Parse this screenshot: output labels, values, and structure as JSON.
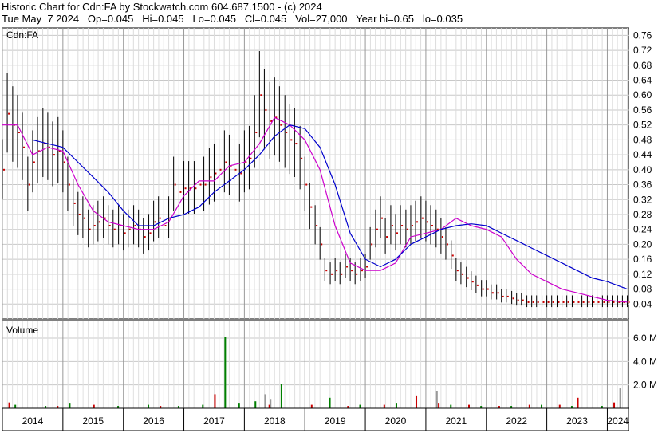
{
  "header": {
    "line1": "Historic Chart for Cdn:FA by Stockwatch.com 604.687.1500 - (c) 2024",
    "line2": "Tue May  7 2024   Op=0.045   Hi=0.045   Lo=0.045   Cl=0.045   Vol=27,000   Year hi=0.65   lo=0.035"
  },
  "chart_data": [
    {
      "type": "line",
      "title": "Cdn:FA",
      "ylim": [
        0.0,
        0.78
      ],
      "y_ticks": [
        "0.76",
        "0.72",
        "0.68",
        "0.64",
        "0.60",
        "0.56",
        "0.52",
        "0.48",
        "0.44",
        "0.40",
        "0.36",
        "0.32",
        "0.28",
        "0.24",
        "0.20",
        "0.16",
        "0.12",
        "0.08",
        "0.04"
      ],
      "x_labels": [
        "2014",
        "2015",
        "2016",
        "2017",
        "2018",
        "2019",
        "2020",
        "2021",
        "2022",
        "2023",
        "2024"
      ],
      "grid": true,
      "series": [
        {
          "style": "price-bars",
          "color": "#000000",
          "x": [
            2014.0,
            2014.08,
            2014.17,
            2014.25,
            2014.33,
            2014.42,
            2014.5,
            2014.58,
            2014.67,
            2014.75,
            2014.83,
            2014.92,
            2015.0,
            2015.08,
            2015.17,
            2015.25,
            2015.33,
            2015.42,
            2015.5,
            2015.58,
            2015.67,
            2015.75,
            2015.83,
            2015.92,
            2016.0,
            2016.08,
            2016.17,
            2016.25,
            2016.33,
            2016.42,
            2016.5,
            2016.58,
            2016.67,
            2016.75,
            2016.83,
            2016.92,
            2017.0,
            2017.08,
            2017.17,
            2017.25,
            2017.33,
            2017.42,
            2017.5,
            2017.58,
            2017.67,
            2017.75,
            2017.83,
            2017.92,
            2018.0,
            2018.08,
            2018.17,
            2018.25,
            2018.33,
            2018.42,
            2018.5,
            2018.58,
            2018.67,
            2018.75,
            2018.83,
            2018.92,
            2019.0,
            2019.08,
            2019.17,
            2019.25,
            2019.33,
            2019.42,
            2019.5,
            2019.58,
            2019.67,
            2019.75,
            2019.83,
            2019.92,
            2020.0,
            2020.08,
            2020.17,
            2020.25,
            2020.33,
            2020.42,
            2020.5,
            2020.58,
            2020.67,
            2020.75,
            2020.83,
            2020.92,
            2021.0,
            2021.08,
            2021.17,
            2021.25,
            2021.33,
            2021.42,
            2021.5,
            2021.58,
            2021.67,
            2021.75,
            2021.83,
            2021.92,
            2022.0,
            2022.08,
            2022.17,
            2022.25,
            2022.33,
            2022.42,
            2022.5,
            2022.58,
            2022.67,
            2022.75,
            2022.83,
            2022.92,
            2023.0,
            2023.08,
            2023.17,
            2023.25,
            2023.33,
            2023.42,
            2023.5,
            2023.58,
            2023.67,
            2023.75,
            2023.83,
            2023.92,
            2024.0,
            2024.08,
            2024.17,
            2024.25,
            2024.33
          ],
          "close": [
            0.4,
            0.55,
            0.52,
            0.5,
            0.46,
            0.36,
            0.42,
            0.45,
            0.47,
            0.46,
            0.44,
            0.45,
            0.42,
            0.36,
            0.31,
            0.28,
            0.27,
            0.24,
            0.25,
            0.26,
            0.27,
            0.25,
            0.24,
            0.25,
            0.23,
            0.24,
            0.25,
            0.24,
            0.22,
            0.23,
            0.26,
            0.27,
            0.25,
            0.27,
            0.36,
            0.34,
            0.35,
            0.35,
            0.35,
            0.36,
            0.36,
            0.38,
            0.39,
            0.4,
            0.42,
            0.41,
            0.4,
            0.39,
            0.42,
            0.43,
            0.5,
            0.6,
            0.56,
            0.53,
            0.54,
            0.52,
            0.5,
            0.48,
            0.47,
            0.43,
            0.36,
            0.3,
            0.25,
            0.2,
            0.13,
            0.12,
            0.13,
            0.12,
            0.14,
            0.13,
            0.12,
            0.13,
            0.14,
            0.2,
            0.24,
            0.27,
            0.22,
            0.25,
            0.23,
            0.25,
            0.24,
            0.25,
            0.26,
            0.27,
            0.26,
            0.25,
            0.24,
            0.22,
            0.2,
            0.17,
            0.13,
            0.12,
            0.11,
            0.1,
            0.09,
            0.08,
            0.08,
            0.07,
            0.07,
            0.06,
            0.06,
            0.055,
            0.05,
            0.05,
            0.045,
            0.045,
            0.045,
            0.045,
            0.045,
            0.045,
            0.045,
            0.045,
            0.045,
            0.045,
            0.045,
            0.045,
            0.045,
            0.045,
            0.045,
            0.045,
            0.045,
            0.045,
            0.045,
            0.045,
            0.045
          ]
        },
        {
          "style": "moving-average-short",
          "color": "#cc00cc",
          "x": [
            2014.0,
            2014.25,
            2014.5,
            2014.75,
            2015.0,
            2015.25,
            2015.5,
            2015.75,
            2016.0,
            2016.25,
            2016.5,
            2016.75,
            2017.0,
            2017.25,
            2017.5,
            2017.75,
            2018.0,
            2018.25,
            2018.5,
            2018.75,
            2019.0,
            2019.25,
            2019.5,
            2019.75,
            2020.0,
            2020.25,
            2020.5,
            2020.75,
            2021.0,
            2021.25,
            2021.5,
            2021.75,
            2022.0,
            2022.25,
            2022.5,
            2022.75,
            2023.0,
            2023.25,
            2023.5,
            2023.75,
            2024.0,
            2024.33
          ],
          "y": [
            0.52,
            0.52,
            0.44,
            0.46,
            0.45,
            0.36,
            0.29,
            0.26,
            0.25,
            0.24,
            0.24,
            0.26,
            0.33,
            0.37,
            0.37,
            0.41,
            0.42,
            0.47,
            0.54,
            0.52,
            0.48,
            0.4,
            0.25,
            0.15,
            0.13,
            0.13,
            0.15,
            0.22,
            0.23,
            0.24,
            0.27,
            0.25,
            0.24,
            0.22,
            0.16,
            0.12,
            0.1,
            0.08,
            0.07,
            0.06,
            0.05,
            0.045
          ]
        },
        {
          "style": "moving-average-long",
          "color": "#0000cc",
          "x": [
            2014.5,
            2014.75,
            2015.0,
            2015.25,
            2015.5,
            2015.75,
            2016.0,
            2016.25,
            2016.5,
            2016.75,
            2017.0,
            2017.25,
            2017.5,
            2017.75,
            2018.0,
            2018.25,
            2018.5,
            2018.75,
            2019.0,
            2019.25,
            2019.5,
            2019.75,
            2020.0,
            2020.25,
            2020.5,
            2020.75,
            2021.0,
            2021.25,
            2021.5,
            2021.75,
            2022.0,
            2022.25,
            2022.5,
            2022.75,
            2023.0,
            2023.25,
            2023.5,
            2023.75,
            2024.0,
            2024.33
          ],
          "y": [
            0.48,
            0.47,
            0.46,
            0.42,
            0.38,
            0.34,
            0.29,
            0.25,
            0.25,
            0.27,
            0.28,
            0.3,
            0.34,
            0.37,
            0.4,
            0.44,
            0.49,
            0.52,
            0.51,
            0.46,
            0.36,
            0.23,
            0.16,
            0.14,
            0.16,
            0.2,
            0.22,
            0.24,
            0.25,
            0.255,
            0.25,
            0.23,
            0.21,
            0.19,
            0.17,
            0.15,
            0.13,
            0.11,
            0.1,
            0.08
          ]
        }
      ]
    },
    {
      "type": "bar",
      "title": "Volume",
      "y_ticks": [
        "6.0 M",
        "4.0 M",
        "2.0 M"
      ],
      "ylim": [
        0,
        7.5
      ],
      "series": [
        {
          "name": "",
          "color": "#008000",
          "x": [
            2014.2,
            2014.7,
            2015.1,
            2015.9,
            2016.4,
            2016.9,
            2017.3,
            2017.67,
            2017.9,
            2018.17,
            2018.6,
            2019.4,
            2019.9,
            2020.5,
            2021.4,
            2021.9,
            2022.4,
            2022.9,
            2023.4,
            2023.9
          ],
          "values": [
            0.3,
            0.2,
            0.4,
            0.2,
            0.3,
            0.2,
            0.3,
            6.1,
            0.4,
            0.6,
            2.1,
            0.9,
            0.3,
            0.4,
            0.3,
            0.2,
            0.2,
            0.3,
            0.2,
            0.2
          ]
        },
        {
          "name": "",
          "color": "#cc0000",
          "x": [
            2014.1,
            2014.9,
            2015.5,
            2016.6,
            2017.5,
            2018.4,
            2019.1,
            2019.7,
            2020.3,
            2020.83,
            2021.2,
            2021.7,
            2022.2,
            2022.7,
            2023.2,
            2023.5,
            2024.1
          ],
          "values": [
            0.5,
            0.2,
            0.3,
            0.2,
            1.2,
            0.3,
            0.3,
            0.2,
            0.3,
            1.1,
            0.4,
            0.3,
            0.2,
            0.3,
            0.3,
            0.9,
            0.5
          ]
        },
        {
          "name": "",
          "color": "#999999",
          "x": [
            2018.33,
            2018.42,
            2021.17,
            2024.2
          ],
          "values": [
            1.2,
            0.8,
            1.5,
            1.7
          ]
        }
      ]
    }
  ]
}
